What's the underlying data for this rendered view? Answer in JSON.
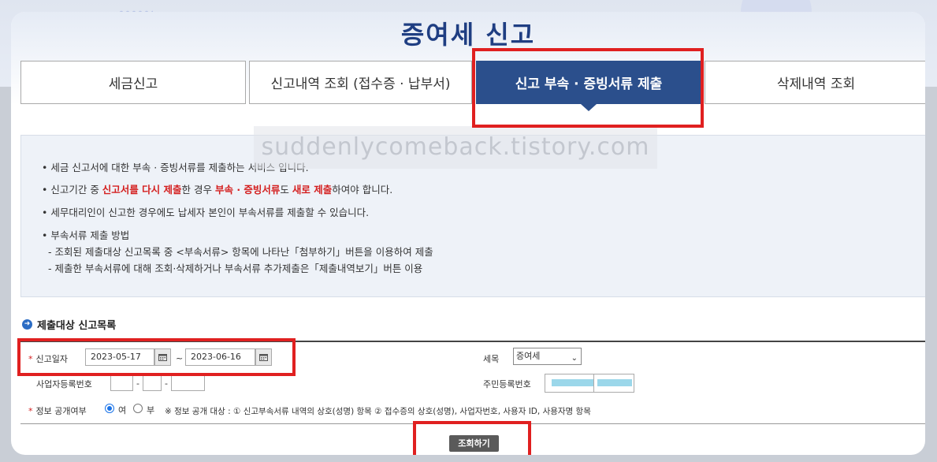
{
  "page_title": "증여세 신고",
  "tabs": [
    {
      "label": "세금신고"
    },
    {
      "label": "신고내역 조회 (접수증 · 납부서)"
    },
    {
      "label": "신고 부속 · 증빙서류 제출",
      "active": true
    },
    {
      "label": "삭제내역 조회"
    }
  ],
  "watermark": "suddenlycomeback.tistory.com",
  "info": {
    "line1": "• 세금 신고서에 대한 부속 · 증빙서류를 제출하는 서비스 입니다.",
    "line2_a": "• 신고기간 중 ",
    "line2_b": "신고서를 다시 제출",
    "line2_c": "한 경우 ",
    "line2_d": "부속 · 증빙서류",
    "line2_e": "도 ",
    "line2_f": "새로 제출",
    "line2_g": "하여야 합니다.",
    "line3": "• 세무대리인이 신고한 경우에도 납세자 본인이 부속서류를 제출할 수 있습니다.",
    "line4": "• 부속서류 제출 방법",
    "sub1": "- 조회된 제출대상 신고목록 중 <부속서류> 항목에 나타난「첨부하기」버튼을 이용하여 제출",
    "sub2": "- 제출한 부속서류에 대해 조회·삭제하거나 부속서류 추가제출은「제출내역보기」버튼 이용"
  },
  "section_title": "제출대상 신고목록",
  "form": {
    "report_date_label": "신고일자",
    "required_mark": "*",
    "date_from": "2023-05-17",
    "date_to": "2023-06-16",
    "date_sep": "~",
    "tax_type_label": "세목",
    "tax_type_value": "증여세",
    "biz_no_label": "사업자등록번호",
    "dash": "-",
    "resident_no_label": "주민등록번호",
    "disclosure_label": "정보 공개여부",
    "radio_yes": "여",
    "radio_no": "부",
    "disclosure_selected": "여",
    "disclosure_note": "※ 정보 공개 대상 : ① 신고부속서류 내역의 상호(성명) 항목 ② 접수증의 상호(성명), 사업자번호, 사용자 ID, 사용자명 항목"
  },
  "search_button": "조회하기",
  "colors": {
    "accent": "#2b4f8c",
    "title": "#1f3e82",
    "highlight_box": "#e02020",
    "required": "#d42020"
  }
}
